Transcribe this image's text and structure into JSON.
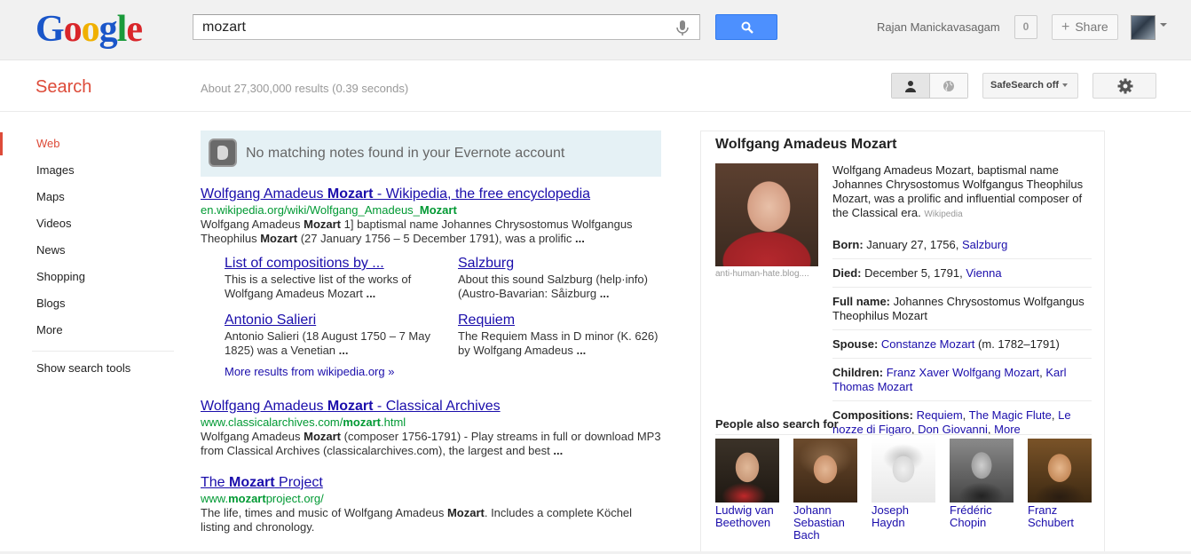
{
  "header": {
    "logo_letters": [
      {
        "char": "G",
        "color": "#1a56c9"
      },
      {
        "char": "o",
        "color": "#d9262a"
      },
      {
        "char": "o",
        "color": "#f0b000"
      },
      {
        "char": "g",
        "color": "#1a56c9"
      },
      {
        "char": "l",
        "color": "#1a9a3a"
      },
      {
        "char": "e",
        "color": "#d9262a"
      }
    ],
    "search_query": "mozart",
    "search_button_icon": "magnifier-icon",
    "mic_icon": "microphone-icon",
    "user_name": "Rajan Manickavasagam",
    "notification_count": "0",
    "share_label": "Share"
  },
  "subbar": {
    "section_label": "Search",
    "result_stats": "About 27,300,000 results (0.39 seconds)",
    "safesearch_label": "SafeSearch off"
  },
  "nav": {
    "items": [
      {
        "label": "Web",
        "active": true
      },
      {
        "label": "Images",
        "active": false
      },
      {
        "label": "Maps",
        "active": false
      },
      {
        "label": "Videos",
        "active": false
      },
      {
        "label": "News",
        "active": false
      },
      {
        "label": "Shopping",
        "active": false
      },
      {
        "label": "Blogs",
        "active": false
      },
      {
        "label": "More",
        "active": false
      }
    ],
    "tools_label": "Show search tools"
  },
  "evernote": {
    "message": "No matching notes found in your Evernote account"
  },
  "results": [
    {
      "title_pre": "Wolfgang Amadeus ",
      "title_bold": "Mozart",
      "title_post": " - Wikipedia, the free encyclopedia",
      "url_pre": "en.wikipedia.org/wiki/Wolfgang_Amadeus_",
      "url_bold": "Mozart",
      "url_post": "",
      "snippet_parts": [
        {
          "t": "Wolfgang Amadeus ",
          "b": false
        },
        {
          "t": "Mozart",
          "b": true
        },
        {
          "t": " 1] baptismal name Johannes Chrysostomus Wolfgangus Theophilus ",
          "b": false
        },
        {
          "t": "Mozart",
          "b": true
        },
        {
          "t": " (27 January 1756 – 5 December 1791), was a prolific ",
          "b": false
        },
        {
          "t": "...",
          "b": true
        }
      ]
    },
    {
      "title_pre": "Wolfgang Amadeus ",
      "title_bold": "Mozart",
      "title_post": " - Classical Archives",
      "url_pre": "www.classicalarchives.com/",
      "url_bold": "mozart",
      "url_post": ".html",
      "snippet_parts": [
        {
          "t": "Wolfgang Amadeus ",
          "b": false
        },
        {
          "t": "Mozart",
          "b": true
        },
        {
          "t": " (composer 1756-1791) - Play streams in full or download MP3 from Classical Archives (classicalarchives.com), the largest and best ",
          "b": false
        },
        {
          "t": "...",
          "b": true
        }
      ]
    },
    {
      "title_pre": "The ",
      "title_bold": "Mozart",
      "title_post": " Project",
      "url_pre": "www.",
      "url_bold": "mozart",
      "url_post": "project.org/",
      "snippet_parts": [
        {
          "t": "The life, times and music of Wolfgang Amadeus ",
          "b": false
        },
        {
          "t": "Mozart",
          "b": true
        },
        {
          "t": ". Includes a complete Köchel listing and chronology.",
          "b": false
        }
      ]
    }
  ],
  "sitelinks": [
    {
      "title": "List of compositions by ...",
      "snippet": "This is a selective list of the works of Wolfgang Amadeus Mozart ",
      "ellipsis": "..."
    },
    {
      "title": "Salzburg",
      "snippet": "About this sound Salzburg (help·info) (Austro-Bavarian: Såizburg ",
      "ellipsis": "..."
    },
    {
      "title": "Antonio Salieri",
      "snippet": "Antonio Salieri (18 August 1750 – 7 May 1825) was a Venetian ",
      "ellipsis": "..."
    },
    {
      "title": "Requiem",
      "snippet": "The Requiem Mass in D minor (K. 626) by Wolfgang Amadeus ",
      "ellipsis": "..."
    }
  ],
  "more_results_label": "More results from wikipedia.org »",
  "knowledge_panel": {
    "title": "Wolfgang Amadeus Mozart",
    "photo_credit": "anti-human-hate.blog....",
    "description": "Wolfgang Amadeus Mozart, baptismal name Johannes Chrysostomus Wolfgangus Theophilus Mozart, was a prolific and influential composer of the Classical era.",
    "description_source": "Wikipedia",
    "facts": {
      "born_label": "Born:",
      "born_value": "January 27, 1756, ",
      "born_link": "Salzburg",
      "died_label": "Died:",
      "died_value": "December 5, 1791, ",
      "died_link": "Vienna",
      "fullname_label": "Full name:",
      "fullname_value": "Johannes Chrysostomus Wolfgangus Theophilus Mozart",
      "spouse_label": "Spouse:",
      "spouse_link": "Constanze Mozart",
      "spouse_value": " (m. 1782–1791)",
      "children_label": "Children:",
      "children_link1": "Franz Xaver Wolfgang Mozart",
      "children_link2": "Karl Thomas Mozart",
      "compositions_label": "Compositions:",
      "comp_link1": "Requiem",
      "comp_link2": "The Magic Flute",
      "comp_link3": "Le nozze di Figaro",
      "comp_link4": "Don Giovanni",
      "comp_more": "More"
    },
    "also_search_label": "People also search for",
    "people": [
      {
        "name": "Ludwig van Beethoven",
        "pic": "pic-beethoven"
      },
      {
        "name": "Johann Sebastian Bach",
        "pic": "pic-bach"
      },
      {
        "name": "Joseph Haydn",
        "pic": "pic-haydn"
      },
      {
        "name": "Frédéric Chopin",
        "pic": "pic-chopin"
      },
      {
        "name": "Franz Schubert",
        "pic": "pic-schubert"
      }
    ]
  }
}
